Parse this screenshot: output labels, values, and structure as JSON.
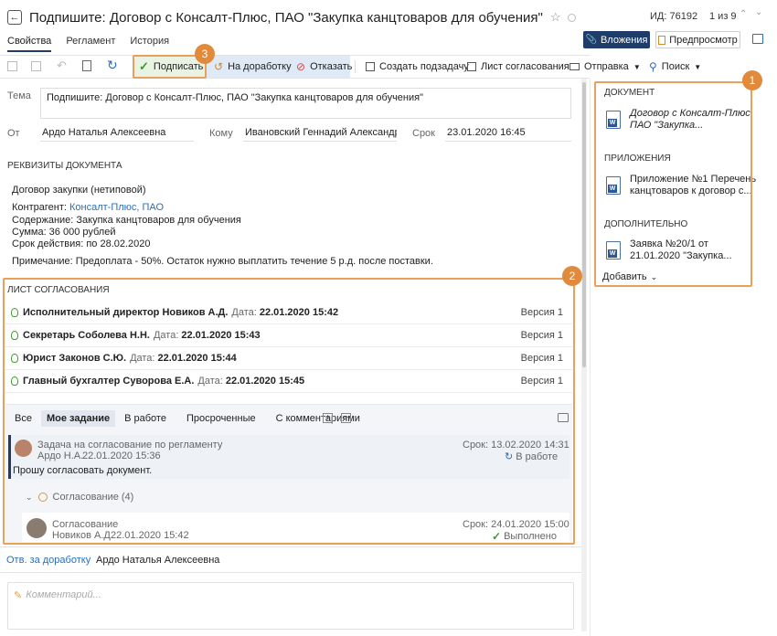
{
  "header": {
    "title": "Подпишите: Договор с Консалт-Плюс, ПАО \"Закупка канцтоваров для обучения\"",
    "id_label": "ИД: 76192",
    "pager": "1 из 9"
  },
  "tabs": [
    "Свойства",
    "Регламент",
    "История"
  ],
  "buttons": {
    "attachments": "Вложения",
    "preview": "Предпросмотр"
  },
  "toolbar": {
    "sign": "Подписать",
    "revise": "На доработку",
    "reject": "Отказать",
    "create_subtask": "Создать подзадачу",
    "approval_list": "Лист согласования",
    "send": "Отправка",
    "search": "Поиск"
  },
  "form": {
    "theme_label": "Тема",
    "theme_value": "Подпишите: Договор с Консалт-Плюс, ПАО \"Закупка канцтоваров для обучения\"",
    "from_label": "От",
    "from_value": "Ардо Наталья Алексеевна",
    "to_label": "Кому",
    "to_value": "Ивановский Геннадий Александрович",
    "term_label": "Срок",
    "term_value": "23.01.2020 16:45"
  },
  "requisites": {
    "title": "РЕКВИЗИТЫ ДОКУМЕНТА",
    "contract_type": "Договор закупки (нетиповой)",
    "counterparty_label": "Контрагент:",
    "counterparty_value": "Консалт-Плюс, ПАО",
    "content": "Содержание: Закупка канцтоваров для обучения",
    "sum": "Сумма: 36 000 рублей",
    "validity": "Срок действия: по 28.02.2020",
    "note": "Примечание: Предоплата - 50%. Остаток нужно выплатить течение 5 р.д. после поставки."
  },
  "approval": {
    "title": "ЛИСТ СОГЛАСОВАНИЯ",
    "rows": [
      {
        "name": "Исполнительный директор Новиков А.Д.",
        "date_label": "Дата:",
        "date": "22.01.2020 15:42",
        "version": "Версия 1"
      },
      {
        "name": "Секретарь Соболева Н.Н.",
        "date_label": "Дата:",
        "date": "22.01.2020 15:43",
        "version": "Версия 1"
      },
      {
        "name": "Юрист Законов С.Ю.",
        "date_label": "Дата:",
        "date": "22.01.2020 15:44",
        "version": "Версия 1"
      },
      {
        "name": "Главный бухгалтер Суворова Е.А.",
        "date_label": "Дата:",
        "date": "22.01.2020 15:45",
        "version": "Версия 1"
      }
    ]
  },
  "filters": [
    "Все",
    "Мое задание",
    "В работе",
    "Просроченные",
    "С комментариями"
  ],
  "task": {
    "title": "Задача на согласование по регламенту",
    "author": "Ардо Н.А.",
    "date": "22.01.2020 15:36",
    "deadline": "Срок: 13.02.2020 14:31",
    "status": "В работе",
    "message": "Прошу согласовать документ."
  },
  "group": {
    "title": "Согласование (4)"
  },
  "subtask": {
    "title": "Согласование",
    "author": "Новиков А.Д.",
    "date": "22.01.2020 15:42",
    "deadline": "Срок: 24.01.2020 15:00",
    "status": "Выполнено"
  },
  "responsible": {
    "label": "Отв. за доработку",
    "value": "Ардо Наталья Алексеевна"
  },
  "comment": {
    "placeholder": "Комментарий..."
  },
  "sidebar": {
    "document_title": "ДОКУМЕНТ",
    "document_lines": [
      "Договор с Консалт-Плюс,",
      "ПАО \"Закупка..."
    ],
    "attachments_title": "ПРИЛОЖЕНИЯ",
    "attachment_lines": [
      "Приложение №1 Перечень",
      "канцтоваров к договор с..."
    ],
    "extra_title": "ДОПОЛНИТЕЛЬНО",
    "extra_lines": [
      "Заявка №20/1 от",
      "21.01.2020 \"Закупка..."
    ],
    "add": "Добавить"
  },
  "callouts": [
    "1",
    "2",
    "3"
  ],
  "colors": {
    "accent": "#1f3d6b",
    "callout": "#e18a3c",
    "sign_bg": "#e9f3e3",
    "toolbar_bg": "#dfeaf6"
  }
}
